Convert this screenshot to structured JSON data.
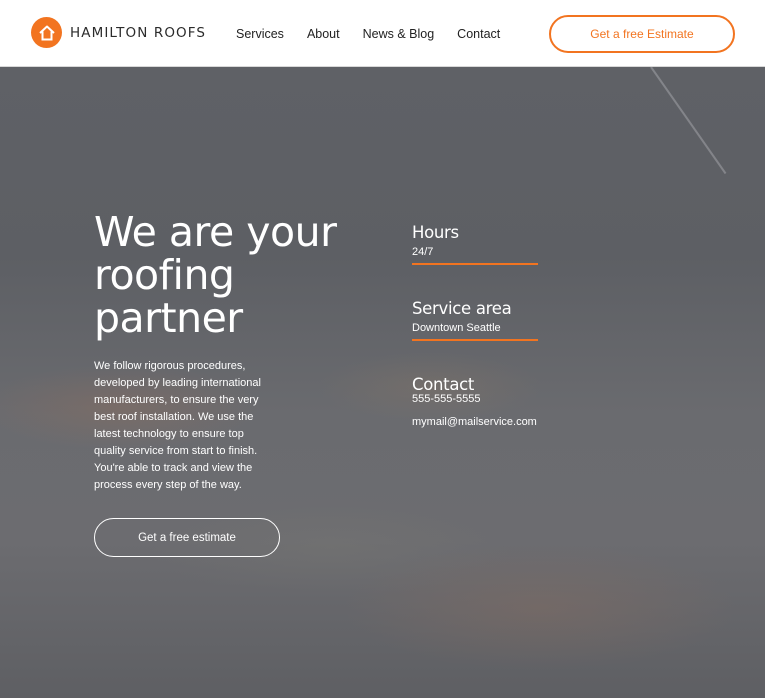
{
  "brand": {
    "name": "HAMILTON ROOFS",
    "accent": "#f27420"
  },
  "nav": {
    "items": [
      {
        "label": "Services"
      },
      {
        "label": "About"
      },
      {
        "label": "News & Blog"
      },
      {
        "label": "Contact"
      }
    ],
    "cta_label": "Get a free Estimate"
  },
  "hero": {
    "title": "We are your roofing partner",
    "description": "We follow rigorous procedures, developed by leading international manufacturers, to ensure the very best roof installation. We use the latest technology to ensure top quality service from start to finish. You're able to track and view the process every step of the way.",
    "cta_label": "Get a free estimate"
  },
  "info": {
    "hours": {
      "title": "Hours",
      "value": "24/7"
    },
    "service_area": {
      "title": "Service area",
      "value": "Downtown Seattle"
    },
    "contact": {
      "title": "Contact",
      "phone": "555-555-5555",
      "email": "mymail@mailservice.com"
    }
  }
}
